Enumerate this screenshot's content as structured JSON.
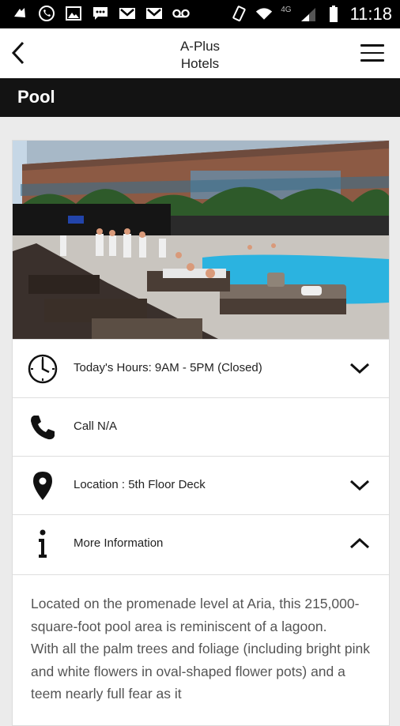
{
  "status_bar": {
    "time": "11:18",
    "network": "4G",
    "left_icons": [
      "notification-icon",
      "whatsapp-icon",
      "image-icon",
      "chat-icon",
      "gmail-icon",
      "gmail-icon",
      "voicemail-icon"
    ],
    "right_icons": [
      "rotate-icon",
      "wifi-icon",
      "signal-icon",
      "battery-icon"
    ]
  },
  "app_bar": {
    "title_line1": "A-Plus",
    "title_line2": "Hotels"
  },
  "section": {
    "title": "Pool"
  },
  "details": [
    {
      "icon": "clock-icon",
      "label": "Today's Hours: 9AM - 5PM (Closed)",
      "expand": "chevron-down-icon"
    },
    {
      "icon": "phone-icon",
      "label": "Call N/A"
    },
    {
      "icon": "location-pin-icon",
      "label": "Location : 5th Floor Deck",
      "expand": "chevron-down-icon"
    },
    {
      "icon": "info-icon",
      "label": "More Information",
      "expand": "chevron-up-icon"
    }
  ],
  "description": {
    "paragraph1": "Located on the promenade level at Aria, this 215,000-square-foot pool area is reminiscent of a lagoon.",
    "paragraph2": "With all the palm trees and foliage (including bright pink and white flowers in oval-shaped flower pots) and a teem nearly full fear as it"
  },
  "colors": {
    "section_bar": "#131313",
    "app_bar": "#ffffff",
    "background": "#ebebeb",
    "pool": "#2bb3e0"
  }
}
